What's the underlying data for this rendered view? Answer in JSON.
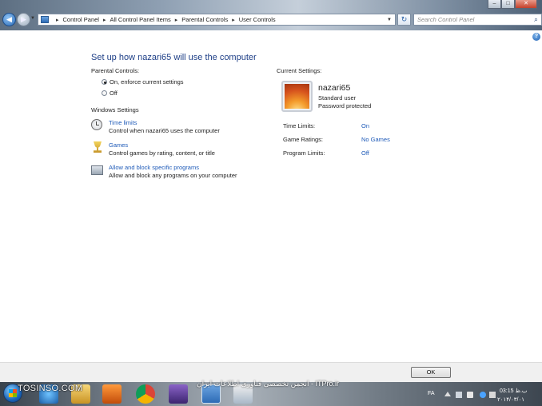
{
  "window": {
    "buttons": {
      "minimize": "–",
      "maximize": "□",
      "close": "✕"
    }
  },
  "navigation": {
    "back_icon": "back-arrow-icon",
    "forward_icon": "forward-arrow-icon"
  },
  "address_bar": {
    "crumbs": [
      "Control Panel",
      "All Control Panel Items",
      "Parental Controls",
      "User Controls"
    ]
  },
  "search": {
    "placeholder": "Search Control Panel"
  },
  "main": {
    "heading": "Set up how nazari65 will use the computer",
    "parental_controls": {
      "label": "Parental Controls:",
      "options": [
        {
          "label": "On, enforce current settings",
          "selected": true
        },
        {
          "label": "Off",
          "selected": false
        }
      ]
    },
    "windows_settings": {
      "label": "Windows Settings",
      "items": [
        {
          "title": "Time limits",
          "description": "Control when nazari65 uses the computer",
          "icon": "clock-icon"
        },
        {
          "title": "Games",
          "description": "Control games by rating, content, or title",
          "icon": "games-icon"
        },
        {
          "title": "Allow and block specific programs",
          "description": "Allow and block any programs on your computer",
          "icon": "programs-icon"
        }
      ]
    },
    "current_settings": {
      "label": "Current Settings:",
      "user": {
        "name": "nazari65",
        "account_type": "Standard user",
        "password_status": "Password protected"
      },
      "rows": [
        {
          "label": "Time Limits:",
          "value": "On"
        },
        {
          "label": "Game Ratings:",
          "value": "No Games"
        },
        {
          "label": "Program Limits:",
          "value": "Off"
        }
      ]
    }
  },
  "footer": {
    "ok_label": "OK"
  },
  "taskbar": {
    "watermark_left": "TOSINSO.COM",
    "watermark_center": "ITPro.ir - انجمن تخصصی فناوری اطلاعات ایران",
    "language": "FA",
    "time": "03:15 ب.ظ",
    "date": "۲۰۱۴/۰۳/۰۱",
    "apps": [
      "windows-explorer",
      "internet-explorer",
      "file-explorer",
      "media-player",
      "chrome",
      "visual-studio",
      "control-panel",
      "paint"
    ]
  }
}
